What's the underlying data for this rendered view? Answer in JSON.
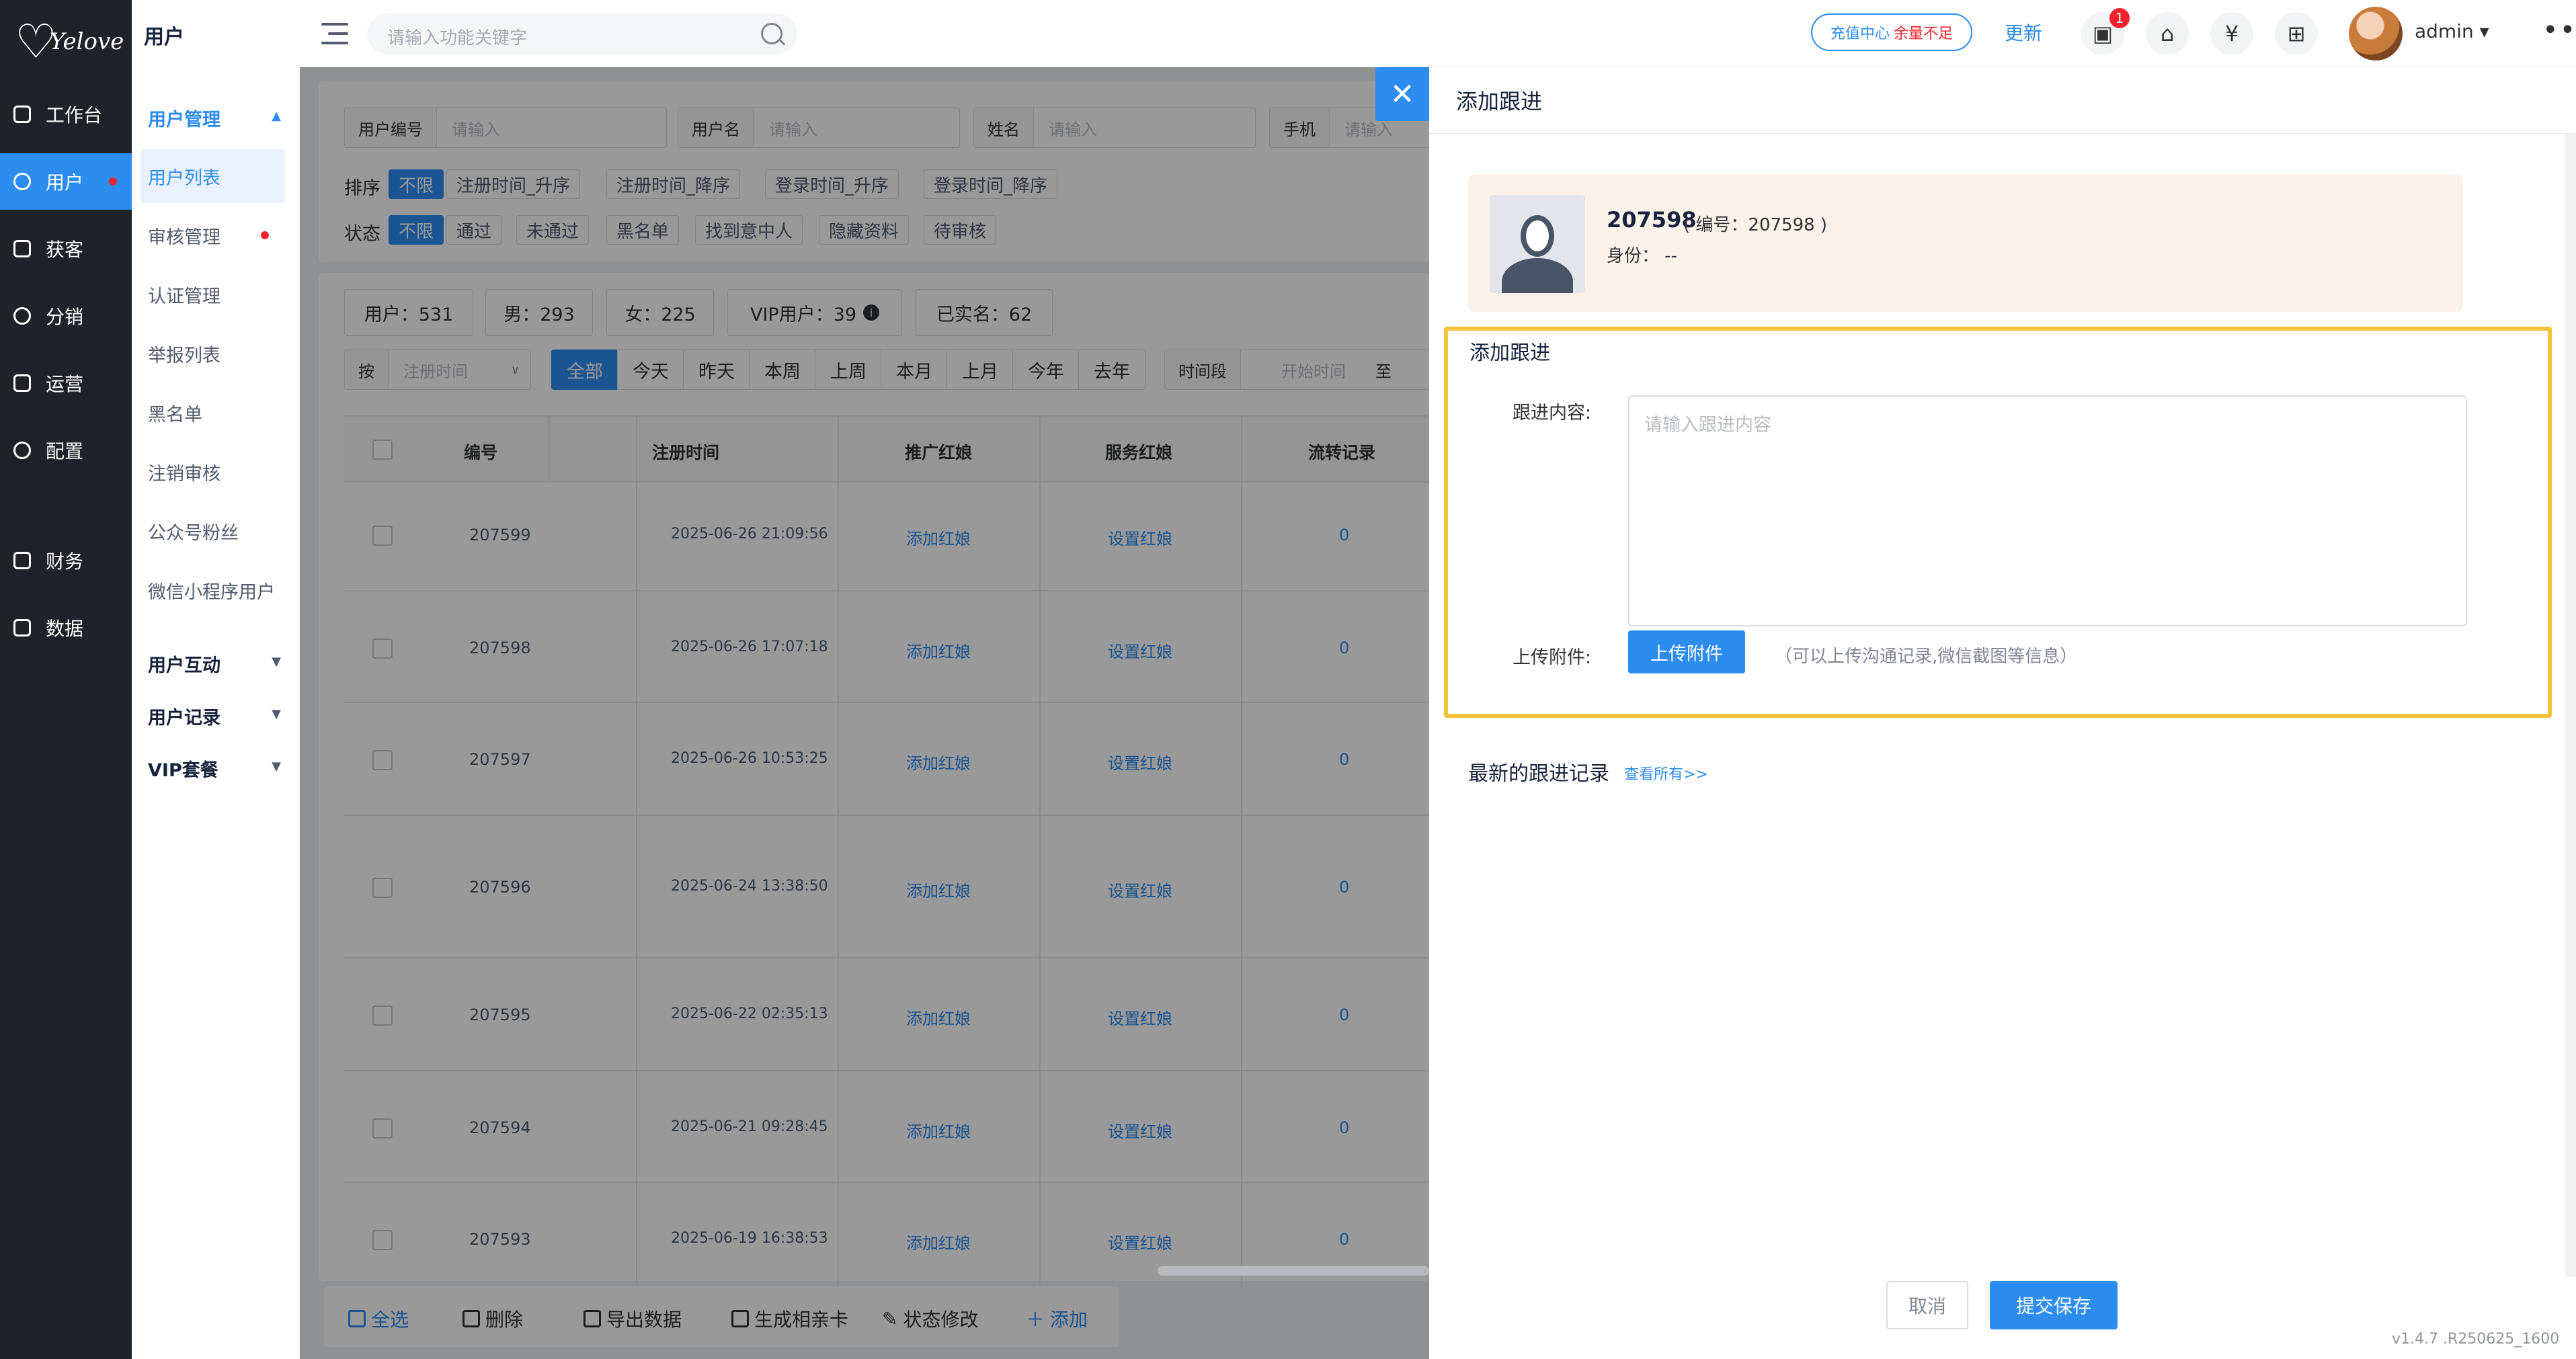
{
  "brand": {
    "logo_text": "Yelove"
  },
  "rail": {
    "items": [
      {
        "label": "工作台",
        "icon": "dashboard-icon"
      },
      {
        "label": "用户",
        "icon": "user-icon",
        "active": true,
        "dot": true
      },
      {
        "label": "获客",
        "icon": "acquire-icon"
      },
      {
        "label": "分销",
        "icon": "share-icon"
      },
      {
        "label": "运营",
        "icon": "operate-icon"
      },
      {
        "label": "配置",
        "icon": "settings-icon"
      },
      {
        "label": "财务",
        "icon": "finance-icon"
      },
      {
        "label": "数据",
        "icon": "chart-icon"
      }
    ]
  },
  "sub": {
    "title": "用户",
    "group1": "用户管理",
    "items": [
      "用户列表",
      "审核管理",
      "认证管理",
      "举报列表",
      "黑名单",
      "注销审核",
      "公众号粉丝",
      "微信小程序用户"
    ],
    "group2": "用户互动",
    "group3": "用户记录",
    "group4": "VIP套餐"
  },
  "header": {
    "search_placeholder": "请输入功能关键字",
    "recharge": "充值中心",
    "recharge_warn": "余量不足",
    "update": "更新",
    "badge": "1",
    "user": "admin"
  },
  "filters": {
    "fields": [
      {
        "label": "用户编号",
        "placeholder": "请输入"
      },
      {
        "label": "用户名",
        "placeholder": "请输入"
      },
      {
        "label": "姓名",
        "placeholder": "请输入"
      },
      {
        "label": "手机",
        "placeholder": "请输入"
      }
    ],
    "sort_label": "排序",
    "sort_options": [
      "不限",
      "注册时间_升序",
      "注册时间_降序",
      "登录时间_升序",
      "登录时间_降序"
    ],
    "status_label": "状态",
    "status_options": [
      "不限",
      "通过",
      "未通过",
      "黑名单",
      "找到意中人",
      "隐藏资料",
      "待审核"
    ]
  },
  "stats": [
    "用户：531",
    "男：293",
    "女：225",
    "VIP用户：39",
    "已实名：62"
  ],
  "range": {
    "by_label": "按",
    "by_value": "注册时间",
    "periods": [
      "全部",
      "今天",
      "昨天",
      "本周",
      "上周",
      "本月",
      "上月",
      "今年",
      "去年"
    ],
    "segment_label": "时间段",
    "start_placeholder": "开始时间",
    "to": "至"
  },
  "table": {
    "headers": [
      "编号",
      "注册时间",
      "推广红娘",
      "服务红娘",
      "流转记录"
    ],
    "rows": [
      {
        "id": "207599",
        "time": "2025-06-26 21:09:56",
        "promo": "添加红娘",
        "service": "设置红娘",
        "flow": "0"
      },
      {
        "id": "207598",
        "time": "2025-06-26 17:07:18",
        "promo": "添加红娘",
        "service": "设置红娘",
        "flow": "0"
      },
      {
        "id": "207597",
        "time": "2025-06-26 10:53:25",
        "promo": "添加红娘",
        "service": "设置红娘",
        "flow": "0"
      },
      {
        "id": "207596",
        "time": "2025-06-24 13:38:50",
        "promo": "添加红娘",
        "service": "设置红娘",
        "flow": "0"
      },
      {
        "id": "207595",
        "time": "2025-06-22 02:35:13",
        "promo": "添加红娘",
        "service": "设置红娘",
        "flow": "0"
      },
      {
        "id": "207594",
        "time": "2025-06-21 09:28:45",
        "promo": "添加红娘",
        "service": "设置红娘",
        "flow": "0"
      },
      {
        "id": "207593",
        "time": "2025-06-19 16:38:53",
        "promo": "添加红娘",
        "service": "设置红娘",
        "flow": "0"
      }
    ]
  },
  "bulk": [
    "全选",
    "删除",
    "导出数据",
    "生成相亲卡",
    "状态修改",
    "添加"
  ],
  "drawer": {
    "title": "添加跟进",
    "user_name": "207598",
    "user_code": "( 编号：207598 )",
    "identity": "身份：  --",
    "section": "添加跟进",
    "content_label": "跟进内容:",
    "content_placeholder": "请输入跟进内容",
    "attach_label": "上传附件:",
    "upload_btn": "上传附件",
    "attach_hint": "（可以上传沟通记录,微信截图等信息）",
    "latest": "最新的跟进记录",
    "view_all": "查看所有>>",
    "cancel": "取消",
    "submit": "提交保存",
    "version": "v1.4.7 .R250625_1600"
  },
  "colors": {
    "accent": "#2d8cf0",
    "rail": "#1f2329",
    "warn": "#f5222d",
    "highlight": "#f5c33b"
  }
}
